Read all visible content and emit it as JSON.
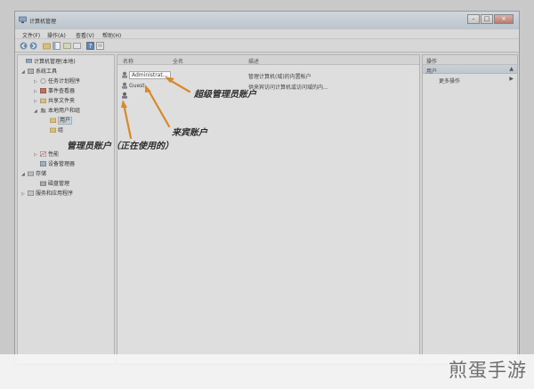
{
  "window": {
    "title": "计算机管理",
    "controls": {
      "minimize": "–",
      "maximize": "□",
      "close": "×"
    }
  },
  "menubar": {
    "items": [
      "文件(F)",
      "操作(A)",
      "查看(V)",
      "帮助(H)"
    ]
  },
  "toolbar": {
    "icons": [
      "back-icon",
      "forward-icon",
      "up-icon",
      "show-hide-tree-icon",
      "refresh-icon",
      "export-icon",
      "help-icon",
      "properties-icon"
    ]
  },
  "tree": {
    "items": [
      {
        "label": "计算机管理(本地)",
        "twisty": "",
        "icon": "computer-icon"
      },
      {
        "label": "系统工具",
        "twisty": "◢",
        "icon": "tools-icon"
      },
      {
        "label": "任务计划程序",
        "twisty": "▷",
        "icon": "clock-icon"
      },
      {
        "label": "事件查看器",
        "twisty": "▷",
        "icon": "event-icon"
      },
      {
        "label": "共享文件夹",
        "twisty": "▷",
        "icon": "folder-icon"
      },
      {
        "label": "本地用户和组",
        "twisty": "◢",
        "icon": "users-icon"
      },
      {
        "label": "用户",
        "twisty": "",
        "icon": "folder-icon"
      },
      {
        "label": "组",
        "twisty": "",
        "icon": "folder-icon"
      },
      {
        "label": "性能",
        "twisty": "▷",
        "icon": "performance-icon"
      },
      {
        "label": "设备管理器",
        "twisty": "",
        "icon": "device-icon"
      },
      {
        "label": "存储",
        "twisty": "◢",
        "icon": "storage-icon"
      },
      {
        "label": "磁盘管理",
        "twisty": "",
        "icon": "disk-icon"
      },
      {
        "label": "服务和应用程序",
        "twisty": "▷",
        "icon": "services-icon"
      }
    ]
  },
  "list": {
    "columns": [
      "名称",
      "全名",
      "描述"
    ],
    "rows": [
      {
        "name": "Administrat...",
        "fullname": "",
        "description": "管理计算机(域)的内置帐户"
      },
      {
        "name": "Guest",
        "fullname": "",
        "description": "供来宾访问计算机或访问域的内..."
      },
      {
        "name": "",
        "fullname": "",
        "description": ""
      }
    ]
  },
  "actions": {
    "header": "操作",
    "section": "用户",
    "section_arrow": "▲",
    "item": "更多操作",
    "item_arrow": "▶"
  },
  "annotations": {
    "super_admin": "超级管理员账户",
    "guest": "来宾账户",
    "admin_in_use": "管理员账户（正在使用的）"
  },
  "watermark": "煎蛋手游",
  "colors": {
    "arrow": "#d9882c",
    "selection": "#c8cfd6"
  }
}
